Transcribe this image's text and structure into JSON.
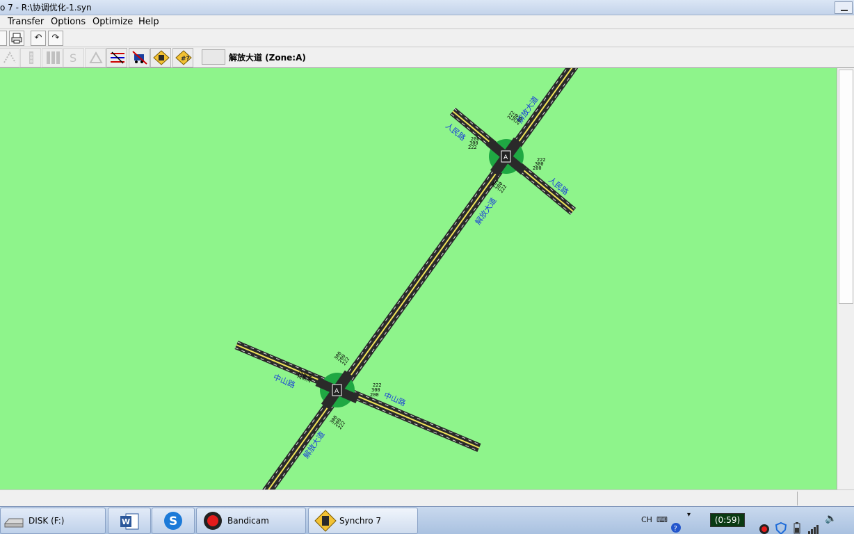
{
  "window": {
    "title": "o 7 - R:\\协调优化-1.syn"
  },
  "menubar": {
    "items": [
      "Transfer",
      "Options",
      "Optimize",
      "Help"
    ]
  },
  "toolbar2": {
    "zone_label": "解放大道 (Zone:A)"
  },
  "map": {
    "background": "#8ef48b",
    "intersection_marker": "A",
    "street_labels": {
      "jiefang_top": "解放大道",
      "jiefang_mid": "解放大道",
      "jiefang_bottom": "解放大道",
      "renmin_left": "人民路",
      "renmin_right": "人民路",
      "zhongshan_left": "中山路",
      "zhongshan_right": "中山路"
    },
    "volume_labels": {
      "upper_n": [
        "222",
        "300",
        "200"
      ],
      "upper_e": [
        "222",
        "300",
        "200"
      ],
      "upper_s": [
        "200",
        "300",
        "222"
      ],
      "upper_w": [
        "200",
        "300",
        "222"
      ],
      "lower_n": [
        "300",
        "200",
        "222"
      ],
      "lower_e": [
        "222",
        "300",
        "200"
      ],
      "lower_s": [
        "300",
        "200",
        "222"
      ],
      "lower_w": [
        "222",
        "300",
        "200"
      ]
    }
  },
  "taskbar": {
    "items": [
      {
        "label": "DISK (F:)"
      },
      {
        "label": ""
      },
      {
        "label": ""
      },
      {
        "label": "Bandicam"
      },
      {
        "label": "Synchro 7"
      }
    ],
    "tray": {
      "lang": "CH",
      "timer": "(0:59)"
    }
  }
}
